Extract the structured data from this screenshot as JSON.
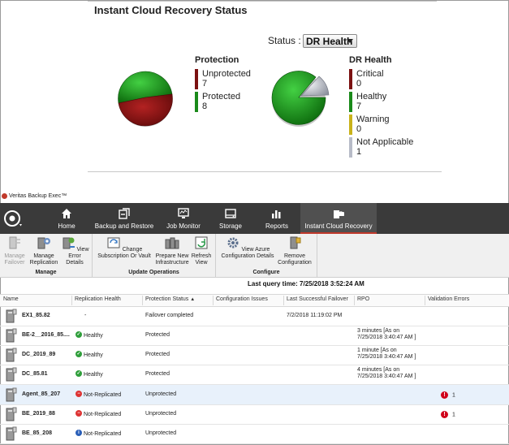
{
  "status_panel": {
    "title": "Instant Cloud Recovery Status",
    "status_label": "Status :",
    "status_selected": "DR Health",
    "protection": {
      "title": "Protection",
      "items": [
        {
          "label": "Unprotected",
          "value": "7",
          "color": "#7b1111"
        },
        {
          "label": "Protected",
          "value": "8",
          "color": "#1a8a1a"
        }
      ]
    },
    "dr_health": {
      "title": "DR Health",
      "items": [
        {
          "label": "Critical",
          "value": "0",
          "color": "#7b1111"
        },
        {
          "label": "Healthy",
          "value": "7",
          "color": "#1a8a1a"
        },
        {
          "label": "Warning",
          "value": "0",
          "color": "#c9b21a"
        },
        {
          "label": "Not Applicable",
          "value": "1",
          "color": "#b8bcc8"
        }
      ]
    }
  },
  "app": {
    "title": "Veritas Backup Exec™",
    "tabs": [
      {
        "label": "Home",
        "icon": "home-icon"
      },
      {
        "label": "Backup and Restore",
        "icon": "backup-restore-icon"
      },
      {
        "label": "Job Monitor",
        "icon": "job-monitor-icon"
      },
      {
        "label": "Storage",
        "icon": "storage-icon"
      },
      {
        "label": "Reports",
        "icon": "reports-icon"
      },
      {
        "label": "Instant Cloud Recovery",
        "icon": "cloud-recovery-icon"
      }
    ],
    "toolbar": {
      "manage": {
        "label": "Manage",
        "buttons": [
          {
            "label1": "Manage",
            "label2": "Failover"
          },
          {
            "label1": "Manage",
            "label2": "Replication"
          },
          {
            "label1": "View Error",
            "label2": "Details"
          }
        ]
      },
      "update": {
        "label": "Update Operations",
        "buttons": [
          {
            "label1": "Change",
            "label2": "Subscription Or Vault"
          },
          {
            "label1": "Prepare New",
            "label2": "Infrastructure"
          },
          {
            "label1": "Refresh",
            "label2": "View"
          }
        ]
      },
      "configure": {
        "label": "Configure",
        "buttons": [
          {
            "label1": "View Azure",
            "label2": "Configuration Details"
          },
          {
            "label1": "Remove",
            "label2": "Configuration"
          }
        ]
      }
    },
    "query_time": "Last query time: 7/25/2018 3:52:24 AM",
    "columns": [
      "Name",
      "Replication Health",
      "Protection Status",
      "Configuration Issues",
      "Last Successful Failover",
      "RPO",
      "Validation Errors"
    ],
    "rows": [
      {
        "name": "EX1_85.82",
        "health": "-",
        "health_icon": "",
        "protection": "Failover completed",
        "last_failover": "7/2/2018 11:19:02 PM",
        "rpo1": "",
        "rpo2": "",
        "errors": ""
      },
      {
        "name": "BE-2__2016_85....",
        "health": "Healthy",
        "health_icon": "healthy-icon",
        "protection": "Protected",
        "last_failover": "",
        "rpo1": "3 minutes  [As on",
        "rpo2": "7/25/2018 3:40:47 AM ]",
        "errors": ""
      },
      {
        "name": "DC_2019_89",
        "health": "Healthy",
        "health_icon": "healthy-icon",
        "protection": "Protected",
        "last_failover": "",
        "rpo1": "1 minute  [As on",
        "rpo2": "7/25/2018 3:40:47 AM ]",
        "errors": ""
      },
      {
        "name": "DC_85.81",
        "health": "Healthy",
        "health_icon": "healthy-icon",
        "protection": "Protected",
        "last_failover": "",
        "rpo1": "4 minutes  [As on",
        "rpo2": "7/25/2018 3:40:47 AM ]",
        "errors": ""
      },
      {
        "name": "Agent_85_207",
        "health": "Not-Replicated",
        "health_icon": "not-replicated-icon",
        "protection": "Unprotected",
        "last_failover": "",
        "rpo1": "",
        "rpo2": "",
        "errors": "1"
      },
      {
        "name": "BE_2019_88",
        "health": "Not-Replicated",
        "health_icon": "not-replicated-icon",
        "protection": "Unprotected",
        "last_failover": "",
        "rpo1": "",
        "rpo2": "",
        "errors": "1"
      },
      {
        "name": "BE_85_208",
        "health": "Not-Replicated",
        "health_icon": "info-icon",
        "protection": "Unprotected",
        "last_failover": "",
        "rpo1": "",
        "rpo2": "",
        "errors": ""
      }
    ]
  }
}
